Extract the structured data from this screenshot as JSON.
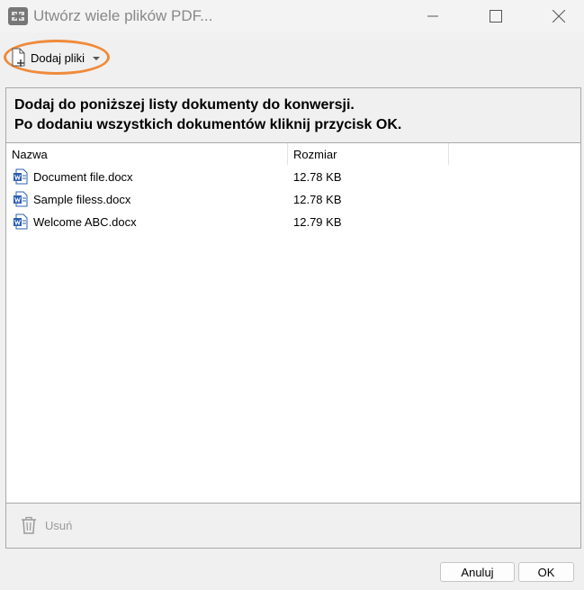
{
  "window": {
    "title": "Utwórz wiele plików PDF..."
  },
  "toolbar": {
    "add_files_label": "Dodaj pliki"
  },
  "instructions": {
    "line1": "Dodaj do poniższej listy dokumenty do konwersji.",
    "line2": "Po dodaniu wszystkich dokumentów kliknij przycisk OK."
  },
  "list": {
    "columns": [
      "Nazwa",
      "Rozmiar"
    ],
    "rows": [
      {
        "name": "Document file.docx",
        "size": "12.78 KB",
        "icon": "word-document-icon"
      },
      {
        "name": "Sample filess.docx",
        "size": "12.78 KB",
        "icon": "word-document-icon"
      },
      {
        "name": "Welcome ABC.docx",
        "size": "12.79 KB",
        "icon": "word-document-icon"
      }
    ]
  },
  "footer": {
    "delete_label": "Usuń"
  },
  "buttons": {
    "cancel_label": "Anuluj",
    "ok_label": "OK"
  },
  "colors": {
    "highlight": "#f08a3a",
    "word_blue": "#2b5fb3",
    "disabled_text": "#9a9a9a"
  }
}
